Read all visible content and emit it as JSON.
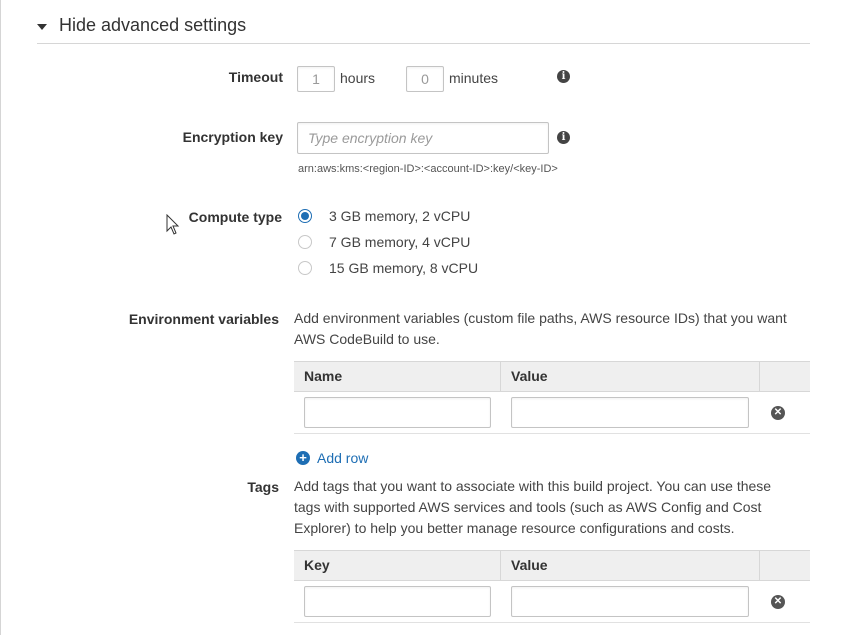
{
  "section": {
    "title": "Hide advanced settings"
  },
  "timeout": {
    "label": "Timeout",
    "hours_value": "1",
    "hours_unit": "hours",
    "minutes_value": "0",
    "minutes_unit": "minutes"
  },
  "encryption": {
    "label": "Encryption key",
    "placeholder": "Type encryption key",
    "hint": "arn:aws:kms:<region-ID>:<account-ID>:key/<key-ID>"
  },
  "compute": {
    "label": "Compute type",
    "options": [
      {
        "label": "3 GB memory, 2 vCPU",
        "selected": true
      },
      {
        "label": "7 GB memory, 4 vCPU",
        "selected": false
      },
      {
        "label": "15 GB memory, 8 vCPU",
        "selected": false
      }
    ]
  },
  "env": {
    "label": "Environment variables",
    "description": "Add environment variables (custom file paths, AWS resource IDs) that you want AWS CodeBuild to use.",
    "col_name": "Name",
    "col_value": "Value",
    "add_row": "Add row"
  },
  "tags": {
    "label": "Tags",
    "description": "Add tags that you want to associate with this build project. You can use these tags with supported AWS services and tools (such as AWS Config and Cost Explorer) to help you better manage resource configurations and costs.",
    "col_key": "Key",
    "col_value": "Value"
  },
  "colors": {
    "accent": "#1e6eb4",
    "text": "#333333",
    "border": "#d7d7d7"
  },
  "icons": {
    "info": "info-icon",
    "remove": "remove-icon",
    "add": "plus-circle-icon",
    "toggle": "caret-down-icon"
  }
}
